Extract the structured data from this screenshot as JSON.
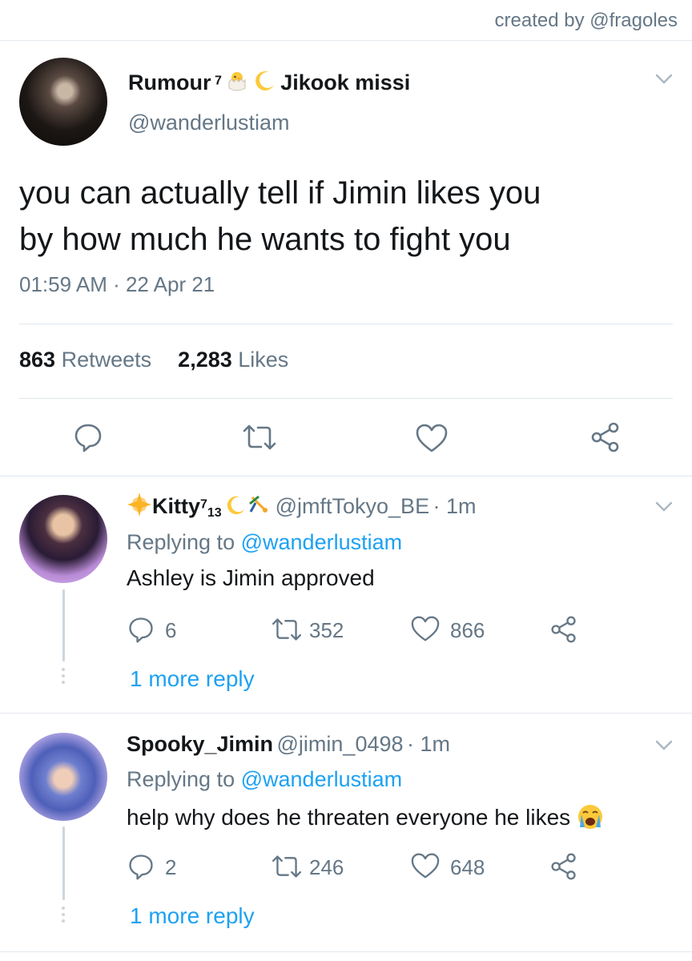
{
  "credit": "created by @fragoles",
  "tweet": {
    "name_left": "Rumour",
    "name_sup": "7",
    "name_right": "Jikook missi",
    "handle": "@wanderlustiam",
    "text_line1": "you can actually tell if Jimin likes you",
    "text_line2": "by how much he wants to fight you",
    "timestamp": "01:59 AM · 22 Apr 21",
    "retweets_count": "863",
    "retweets_label": "Retweets",
    "likes_count": "2,283",
    "likes_label": "Likes"
  },
  "replies": [
    {
      "name": "Kitty",
      "name_sup": "7",
      "name_sub": "13",
      "handle": "@jmftTokyo_BE",
      "time": "· 1m",
      "replying_prefix": "Replying to",
      "replying_to": "@wanderlustiam",
      "text": "Ashley is Jimin approved",
      "reply_count": "6",
      "retweet_count": "352",
      "like_count": "866",
      "more_label": "1 more reply"
    },
    {
      "name": "Spooky_Jimin",
      "handle": "@jimin_0498",
      "time": "· 1m",
      "replying_prefix": "Replying to",
      "replying_to": "@wanderlustiam",
      "text": "help why does he threaten everyone he likes",
      "reply_count": "2",
      "retweet_count": "246",
      "like_count": "648",
      "more_label": "1 more reply"
    }
  ],
  "icons": {
    "chick": "hatching-chick-emoji",
    "moon": "crescent-moon-emoji",
    "star": "sparkle-star-emoji",
    "cartwheel": "cartwheel-person-emoji",
    "crying": "loudly-crying-face-emoji"
  },
  "colors": {
    "link": "#1da1f2",
    "secondary_text": "#657786",
    "divider": "#e1e8ed"
  }
}
